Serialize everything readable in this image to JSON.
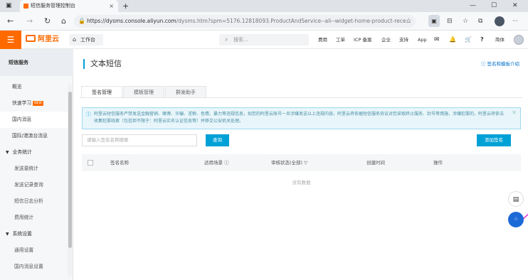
{
  "browser": {
    "tab_title": "短信服务管理控制台",
    "tab_close": "×",
    "new_tab": "+",
    "window_controls": {
      "minimize": "—",
      "maximize": "☐",
      "close": "✕"
    },
    "nav": {
      "back": "←",
      "forward": "→",
      "reload": "↻",
      "home": "⌂"
    },
    "url_main": "https://dysms.console.aliyun.com",
    "url_rest": "/dysms.htm?spm=5176.12818093.ProductAndService--ali--widget-home-product-rece...",
    "toolbar_icons": {
      "favorite": "☆",
      "collections": "⧉",
      "more": "···",
      "split": "⊟",
      "extensions": "▣"
    }
  },
  "header": {
    "menu_icon": "☰",
    "logo_text": "阿里云",
    "workbench": "工作台",
    "search_placeholder": "搜索...",
    "nav_items": [
      "费用",
      "工单",
      "ICP 备案",
      "企业",
      "支持",
      "App"
    ],
    "lang": "简体",
    "icons": {
      "message": "✉",
      "bell": "🔔",
      "cart": "🛒",
      "help": "?"
    }
  },
  "sidebar": {
    "title": "短信服务",
    "items": [
      {
        "label": "概览"
      },
      {
        "label": "快速学习",
        "badge": "NEW"
      },
      {
        "label": "国内消息"
      },
      {
        "label": "国际/港澳台消息"
      }
    ],
    "group_business": "业务统计",
    "business_items": [
      "发送量统计",
      "发送记录查询",
      "短信日志分析",
      "费用统计"
    ],
    "group_settings": "系统设置",
    "settings_items": [
      "通用设置",
      "国内消息设置"
    ]
  },
  "main": {
    "title": "文本短信",
    "help_link": "签名和模板介绍",
    "tabs": [
      "签名管理",
      "模板管理",
      "群发助手"
    ],
    "notice": "阿里云短信服务严禁发送金融营销、赌博、诈骗、淫秽、色情、暴力等违规信息，如您的阿里云账号一旦涉嫌发送以上违规内容，阿里云将依据短信服务协议对您采取终止服务、封号等措施，涉嫌犯罪的，阿里云将依法收集犯罪线索（包括但不限于：阿里云实名认证信息等）并移交公安机关处理。",
    "search_placeholder": "请输入签名名称搜索",
    "query_button": "查询",
    "add_button": "添加签名",
    "columns": [
      "签名名称",
      "适用场景",
      "审核状态(全部)",
      "创建时间",
      "操作"
    ],
    "empty_text": "没有数据"
  },
  "floating": {
    "chat": "▤",
    "apps": "⁘"
  }
}
